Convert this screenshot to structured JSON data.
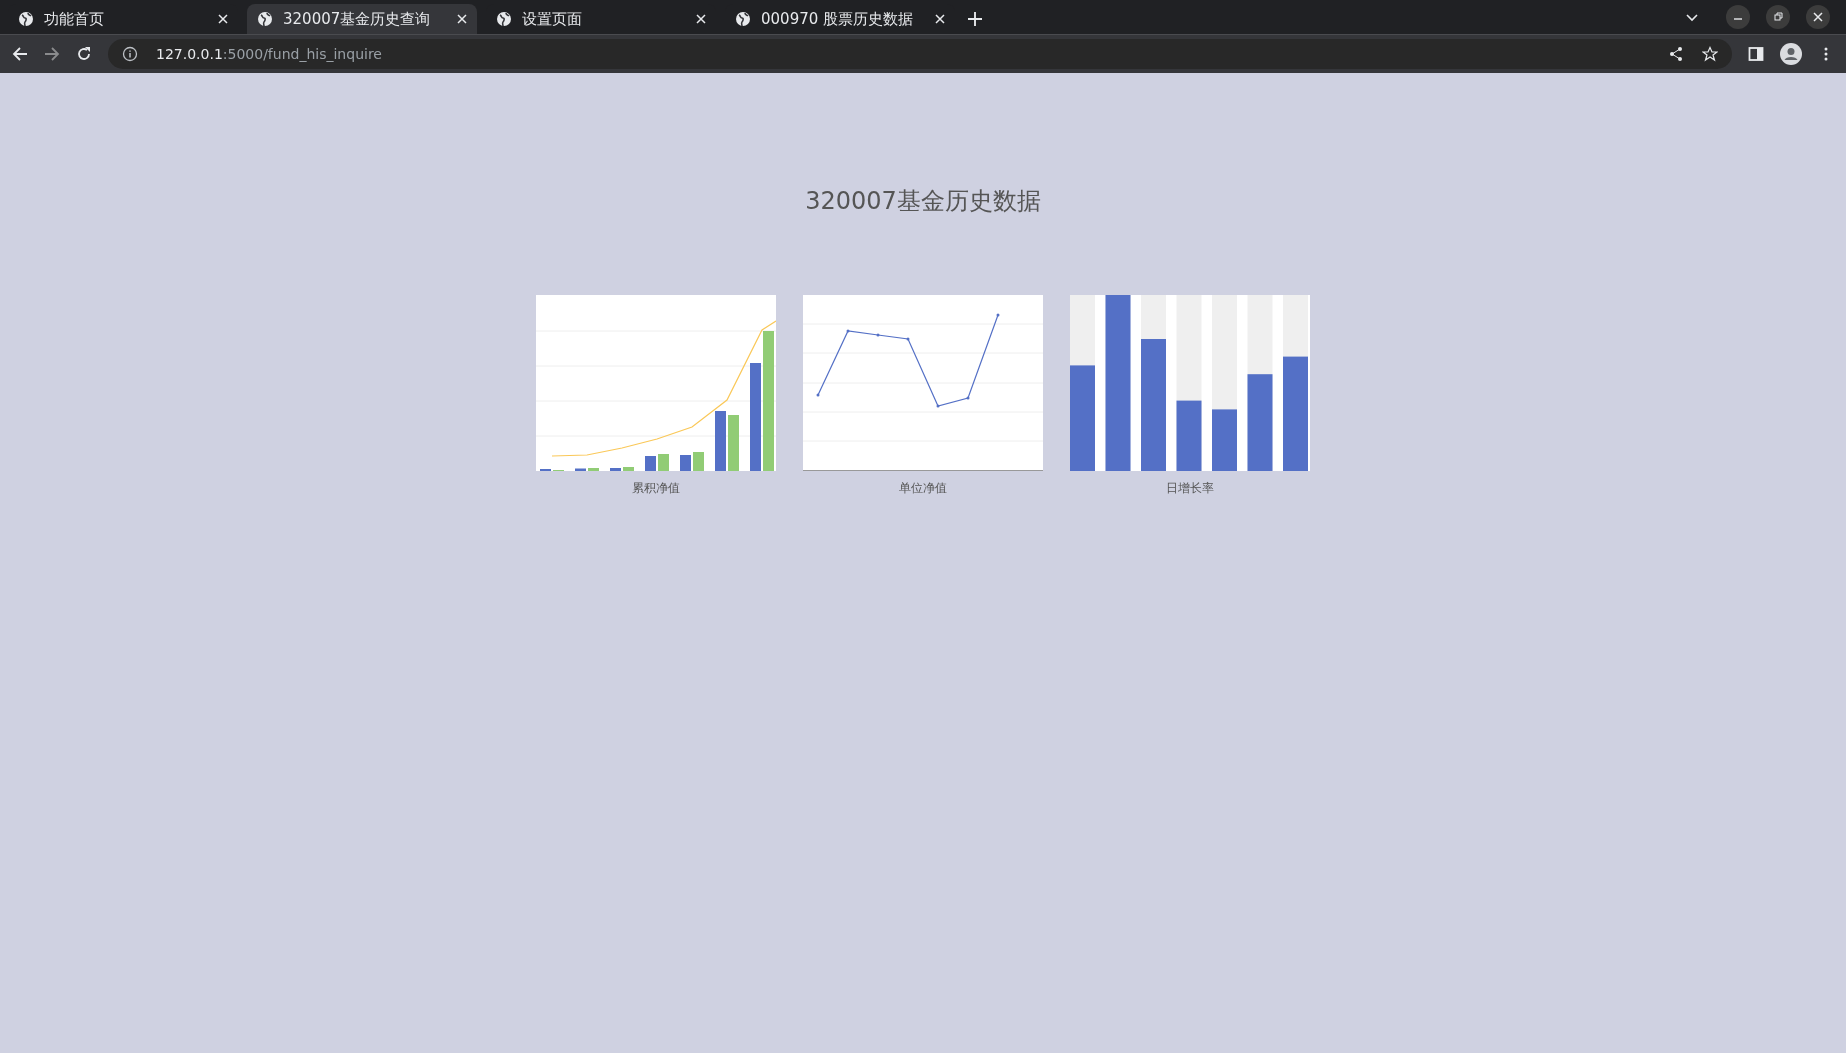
{
  "tabs": [
    {
      "label": "功能首页",
      "selected": false
    },
    {
      "label": "320007基金历史查询",
      "selected": true
    },
    {
      "label": "设置页面",
      "selected": false
    },
    {
      "label": "000970 股票历史数据",
      "selected": false
    }
  ],
  "address_bar": {
    "host": "127.0.0.1",
    "path": ":5000/fund_his_inquire"
  },
  "page": {
    "title": "320007基金历史数据",
    "charts": [
      {
        "kind": "bar-line",
        "caption": "累积净值"
      },
      {
        "kind": "line",
        "caption": "单位净值"
      },
      {
        "kind": "bar",
        "caption": "日增长率"
      }
    ]
  }
}
